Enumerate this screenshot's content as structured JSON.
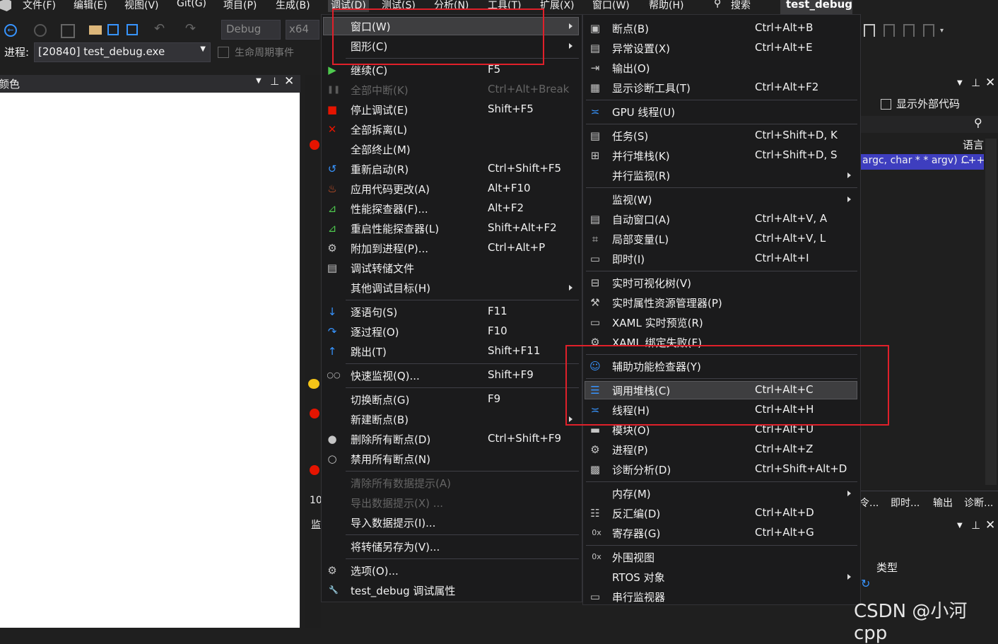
{
  "menubar": [
    "文件(F)",
    "编辑(E)",
    "视图(V)",
    "Git(G)",
    "项目(P)",
    "生成(B)",
    "调试(D)",
    "测试(S)",
    "分析(N)",
    "工具(T)",
    "扩展(X)",
    "窗口(W)",
    "帮助(H)",
    "搜索"
  ],
  "project_tab": "test_debug",
  "toolbar": {
    "config": "Debug",
    "platform": "x64"
  },
  "process_bar": {
    "label": "进程:",
    "process": "[20840] test_debug.exe",
    "lifecycle": "生命周期事件"
  },
  "left_panel_title": "颜色",
  "right_panel": {
    "show_external": "显示外部代码",
    "col_lang": "语言",
    "row_args": "argc, char * * argv) ...",
    "row_lang": "C++",
    "tabs": [
      "令...",
      "即时...",
      "输出",
      "诊断..."
    ],
    "col_type": "类型"
  },
  "editor": {
    "line_no": "10",
    "watch_prefix": "监"
  },
  "debug_menu": {
    "items": [
      {
        "label": "窗口(W)",
        "shortcut": "",
        "icon": "",
        "submenu": true,
        "disabled": false,
        "highlight": true
      },
      {
        "label": "图形(C)",
        "shortcut": "",
        "icon": "",
        "submenu": true,
        "disabled": false
      },
      {
        "sep": true
      },
      {
        "label": "继续(C)",
        "shortcut": "F5",
        "icon": "play-icon",
        "disabled": false
      },
      {
        "label": "全部中断(K)",
        "shortcut": "Ctrl+Alt+Break",
        "icon": "pause-icon",
        "disabled": true
      },
      {
        "label": "停止调试(E)",
        "shortcut": "Shift+F5",
        "icon": "stop-icon",
        "disabled": false
      },
      {
        "label": "全部拆离(L)",
        "shortcut": "",
        "icon": "detach-icon",
        "disabled": false
      },
      {
        "label": "全部终止(M)",
        "shortcut": "",
        "icon": "",
        "disabled": false
      },
      {
        "label": "重新启动(R)",
        "shortcut": "Ctrl+Shift+F5",
        "icon": "restart-icon",
        "disabled": false
      },
      {
        "label": "应用代码更改(A)",
        "shortcut": "Alt+F10",
        "icon": "hot-reload-icon",
        "disabled": false
      },
      {
        "label": "性能探查器(F)...",
        "shortcut": "Alt+F2",
        "icon": "profiler-icon",
        "disabled": false
      },
      {
        "label": "重启性能探查器(L)",
        "shortcut": "Shift+Alt+F2",
        "icon": "profiler-icon",
        "disabled": false
      },
      {
        "label": "附加到进程(P)...",
        "shortcut": "Ctrl+Alt+P",
        "icon": "attach-icon",
        "disabled": false
      },
      {
        "label": "调试转储文件",
        "shortcut": "",
        "icon": "dump-icon",
        "disabled": false
      },
      {
        "label": "其他调试目标(H)",
        "shortcut": "",
        "icon": "",
        "submenu": true,
        "disabled": false
      },
      {
        "sep": true
      },
      {
        "label": "逐语句(S)",
        "shortcut": "F11",
        "icon": "step-into-icon",
        "disabled": false
      },
      {
        "label": "逐过程(O)",
        "shortcut": "F10",
        "icon": "step-over-icon",
        "disabled": false
      },
      {
        "label": "跳出(T)",
        "shortcut": "Shift+F11",
        "icon": "step-out-icon",
        "disabled": false
      },
      {
        "sep": true
      },
      {
        "label": "快速监视(Q)...",
        "shortcut": "Shift+F9",
        "icon": "glasses-icon",
        "disabled": false
      },
      {
        "sep": true
      },
      {
        "label": "切换断点(G)",
        "shortcut": "F9",
        "icon": "",
        "disabled": false
      },
      {
        "label": "新建断点(B)",
        "shortcut": "",
        "icon": "",
        "submenu": true,
        "disabled": false
      },
      {
        "label": "删除所有断点(D)",
        "shortcut": "Ctrl+Shift+F9",
        "icon": "delete-breakpoints-icon",
        "disabled": false
      },
      {
        "label": "禁用所有断点(N)",
        "shortcut": "",
        "icon": "disable-breakpoints-icon",
        "disabled": false
      },
      {
        "sep": true
      },
      {
        "label": "清除所有数据提示(A)",
        "shortcut": "",
        "icon": "",
        "disabled": true
      },
      {
        "label": "导出数据提示(X) ...",
        "shortcut": "",
        "icon": "",
        "disabled": true
      },
      {
        "label": "导入数据提示(I)...",
        "shortcut": "",
        "icon": "",
        "disabled": false
      },
      {
        "sep": true
      },
      {
        "label": "将转储另存为(V)...",
        "shortcut": "",
        "icon": "",
        "disabled": false
      },
      {
        "sep": true
      },
      {
        "label": "选项(O)...",
        "shortcut": "",
        "icon": "gear-icon",
        "disabled": false
      },
      {
        "label": "test_debug 调试属性",
        "shortcut": "",
        "icon": "wrench-icon",
        "disabled": false
      }
    ]
  },
  "window_menu": {
    "items": [
      {
        "label": "断点(B)",
        "shortcut": "Ctrl+Alt+B",
        "icon": "breakpoints-window-icon"
      },
      {
        "label": "异常设置(X)",
        "shortcut": "Ctrl+Alt+E",
        "icon": "exception-icon"
      },
      {
        "label": "输出(O)",
        "shortcut": "",
        "icon": "output-icon"
      },
      {
        "label": "显示诊断工具(T)",
        "shortcut": "Ctrl+Alt+F2",
        "icon": "diagnostic-icon"
      },
      {
        "sep": true
      },
      {
        "label": "GPU 线程(U)",
        "shortcut": "",
        "icon": "gpu-thread-icon"
      },
      {
        "sep": true
      },
      {
        "label": "任务(S)",
        "shortcut": "Ctrl+Shift+D, K",
        "icon": "tasks-icon"
      },
      {
        "label": "并行堆栈(K)",
        "shortcut": "Ctrl+Shift+D, S",
        "icon": "parallel-stacks-icon"
      },
      {
        "label": "并行监视(R)",
        "shortcut": "",
        "icon": "",
        "submenu": true
      },
      {
        "sep": true
      },
      {
        "label": "监视(W)",
        "shortcut": "",
        "icon": "",
        "submenu": true
      },
      {
        "label": "自动窗口(A)",
        "shortcut": "Ctrl+Alt+V, A",
        "icon": "autos-icon"
      },
      {
        "label": "局部变量(L)",
        "shortcut": "Ctrl+Alt+V, L",
        "icon": "locals-icon"
      },
      {
        "label": "即时(I)",
        "shortcut": "Ctrl+Alt+I",
        "icon": "immediate-icon"
      },
      {
        "sep": true
      },
      {
        "label": "实时可视化树(V)",
        "shortcut": "",
        "icon": "visual-tree-icon"
      },
      {
        "label": "实时属性资源管理器(P)",
        "shortcut": "",
        "icon": "property-explorer-icon"
      },
      {
        "label": "XAML 实时预览(R)",
        "shortcut": "",
        "icon": "xaml-preview-icon"
      },
      {
        "label": "XAML 绑定失败(F)",
        "shortcut": "",
        "icon": "xaml-binding-icon"
      },
      {
        "sep": true
      },
      {
        "label": "辅助功能检查器(Y)",
        "shortcut": "",
        "icon": "accessibility-icon"
      },
      {
        "sep": true
      },
      {
        "label": "调用堆栈(C)",
        "shortcut": "Ctrl+Alt+C",
        "icon": "call-stack-icon",
        "highlight": true
      },
      {
        "label": "线程(H)",
        "shortcut": "Ctrl+Alt+H",
        "icon": "threads-icon"
      },
      {
        "label": "模块(O)",
        "shortcut": "Ctrl+Alt+U",
        "icon": "modules-icon"
      },
      {
        "label": "进程(P)",
        "shortcut": "Ctrl+Alt+Z",
        "icon": "processes-icon"
      },
      {
        "label": "诊断分析(D)",
        "shortcut": "Ctrl+Shift+Alt+D",
        "icon": "diagnostic-analysis-icon"
      },
      {
        "sep": true
      },
      {
        "label": "内存(M)",
        "shortcut": "",
        "icon": "",
        "submenu": true
      },
      {
        "label": "反汇编(D)",
        "shortcut": "Ctrl+Alt+D",
        "icon": "disassembly-icon"
      },
      {
        "label": "寄存器(G)",
        "shortcut": "Ctrl+Alt+G",
        "icon": "registers-icon"
      },
      {
        "sep": true
      },
      {
        "label": "外围视图",
        "shortcut": "",
        "icon": "peripheral-icon"
      },
      {
        "label": "RTOS 对象",
        "shortcut": "",
        "icon": "",
        "submenu": true
      },
      {
        "label": "串行监视器",
        "shortcut": "",
        "icon": "serial-monitor-icon"
      }
    ]
  },
  "watermark": "CSDN @小河cpp"
}
